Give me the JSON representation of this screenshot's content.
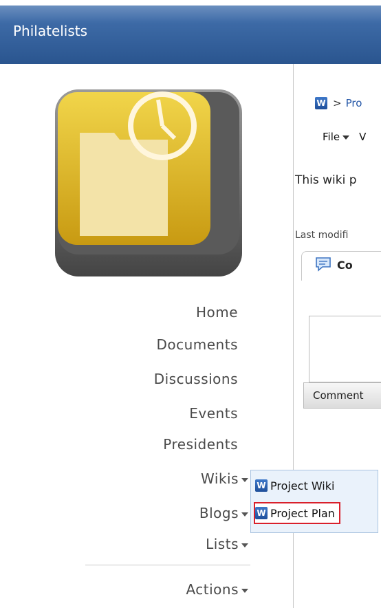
{
  "app": {
    "title": "Philatelists"
  },
  "nav": {
    "items": [
      {
        "label": "Home"
      },
      {
        "label": "Documents"
      },
      {
        "label": "Discussions"
      },
      {
        "label": "Events"
      },
      {
        "label": "Presidents"
      },
      {
        "label": "Wikis"
      },
      {
        "label": "Blogs"
      },
      {
        "label": "Lists"
      }
    ],
    "actions_label": "Actions"
  },
  "dropdown": {
    "items": [
      {
        "label": "Project Wiki",
        "icon": "wiki-icon"
      },
      {
        "label": "Project Plan",
        "icon": "wiki-icon",
        "selected": true
      }
    ]
  },
  "content": {
    "breadcrumb_sep": ">",
    "breadcrumb_text": "Pro",
    "file_menu": "File",
    "view_menu": "V",
    "wiki_text": "This wiki p",
    "last_modified": "Last modifi",
    "comments_tab": "Co",
    "comment_button": "Comment"
  },
  "colors": {
    "header": "#2a558f",
    "selection_outline": "#d9202b",
    "menu_bg": "#eaf2fb"
  }
}
